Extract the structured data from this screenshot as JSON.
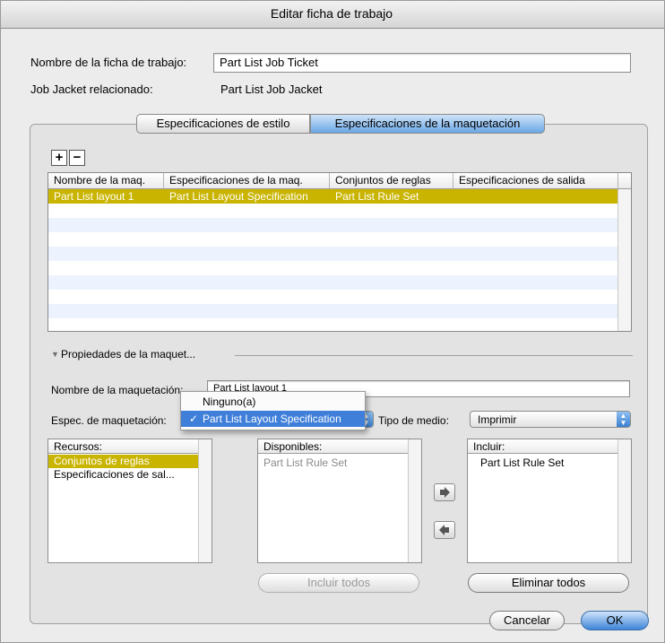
{
  "window": {
    "title": "Editar ficha de trabajo"
  },
  "ticket_name": {
    "label": "Nombre de la ficha de trabajo:",
    "value": "Part List Job Ticket"
  },
  "job_jacket": {
    "label": "Job Jacket relacionado:",
    "value": "Part List Job Jacket"
  },
  "tabs": [
    {
      "label": "Especificaciones de estilo",
      "selected": false
    },
    {
      "label": "Especificaciones de la maquetación",
      "selected": true
    }
  ],
  "toolbar": {
    "add": "+",
    "remove": "−"
  },
  "layout_table": {
    "columns": [
      "Nombre de la maq.",
      "Especificaciones de la maq.",
      "Conjuntos de reglas",
      "Especificaciones de salida"
    ],
    "rows": [
      [
        "Part List layout 1",
        "Part List Layout Specification",
        "Part List Rule Set",
        ""
      ]
    ],
    "selected_color": "#c9b400"
  },
  "properties": {
    "disclosure_label": "Propiedades de la maquet...",
    "layout_name_label": "Nombre de la maquetación:",
    "layout_name_value": "Part List layout 1",
    "spec_label": "Espec. de maquetación:",
    "spec_value": "Part List Layout Specification",
    "media_label": "Tipo de medio:",
    "media_value": "Imprimir"
  },
  "spec_menu": {
    "items": [
      "Ninguno(a)",
      "Part List Layout Specification"
    ],
    "checked": "✓"
  },
  "resources": {
    "header": "Recursos:",
    "items": [
      "Conjuntos de reglas",
      "Especificaciones de sal..."
    ]
  },
  "available": {
    "header": "Disponibles:",
    "items": [
      "Part List Rule Set"
    ]
  },
  "include": {
    "header": "Incluir:",
    "items": [
      "Part List Rule Set"
    ]
  },
  "buttons": {
    "include_all": "Incluir todos",
    "remove_all": "Eliminar todos",
    "cancel": "Cancelar",
    "ok": "OK"
  }
}
